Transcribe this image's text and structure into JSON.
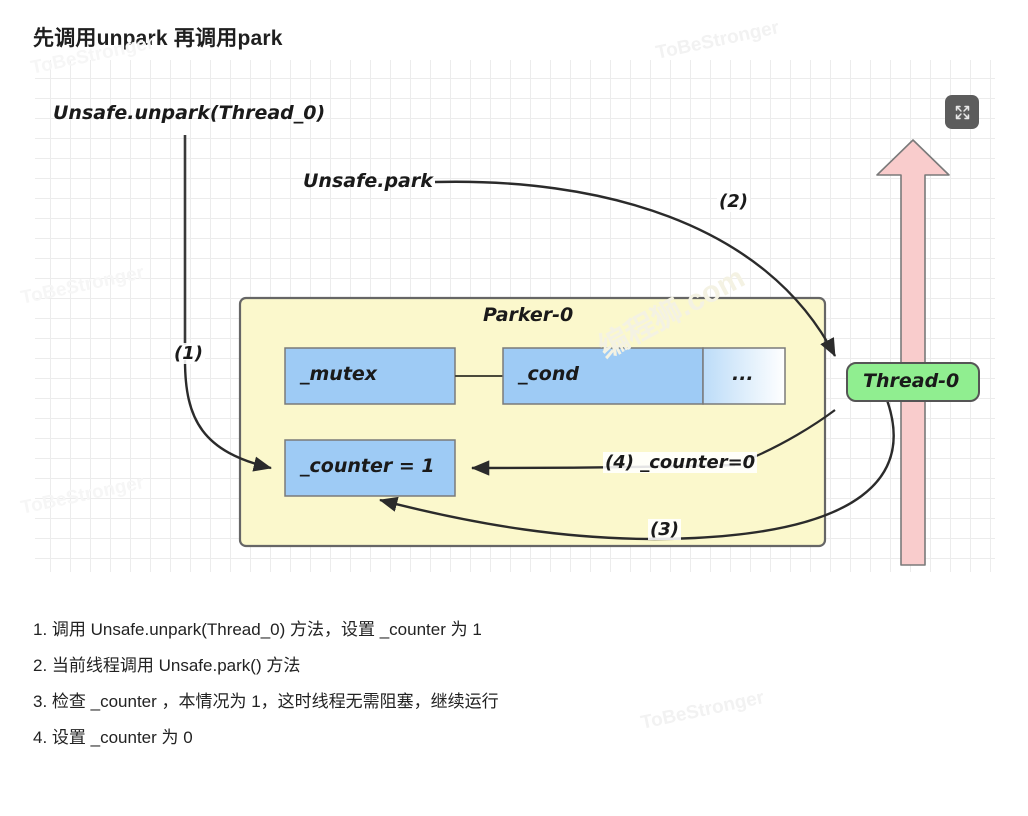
{
  "page": {
    "title": "先调用unpark 再调用park"
  },
  "toolbar": {
    "fullscreen_label": "fullscreen-icon"
  },
  "diagram": {
    "labels": {
      "unpark_call": "Unsafe.unpark(Thread_0)",
      "park_call": "Unsafe.park",
      "parker_title": "Parker-0",
      "thread_box": "Thread-0"
    },
    "fields": {
      "mutex": "_mutex",
      "cond": "_cond",
      "ellipsis": "...",
      "counter": "_counter = 1"
    },
    "annotations": {
      "step1": "(1)",
      "step2": "(2)",
      "step3": "(3)",
      "step4": "(4) _counter=0"
    },
    "colors": {
      "parker_fill": "#fbf8cc",
      "parker_stroke": "#666666",
      "field_fill": "#9ecbf5",
      "field_stroke": "#7a7a7a",
      "thread_fill": "#90ee90",
      "thread_stroke": "#555555",
      "big_arrow_fill": "#f9cccc",
      "big_arrow_stroke": "#7a7a7a",
      "connector": "#2b2b2b"
    }
  },
  "steps": [
    "1. 调用 Unsafe.unpark(Thread_0) 方法，设置 _counter 为 1",
    "2. 当前线程调用 Unsafe.park() 方法",
    "3. 检查 _counter ，本情况为 1，这时线程无需阻塞，继续运行",
    "4. 设置 _counter 为 0"
  ],
  "watermarks": {
    "text": "ToBeStronger"
  }
}
